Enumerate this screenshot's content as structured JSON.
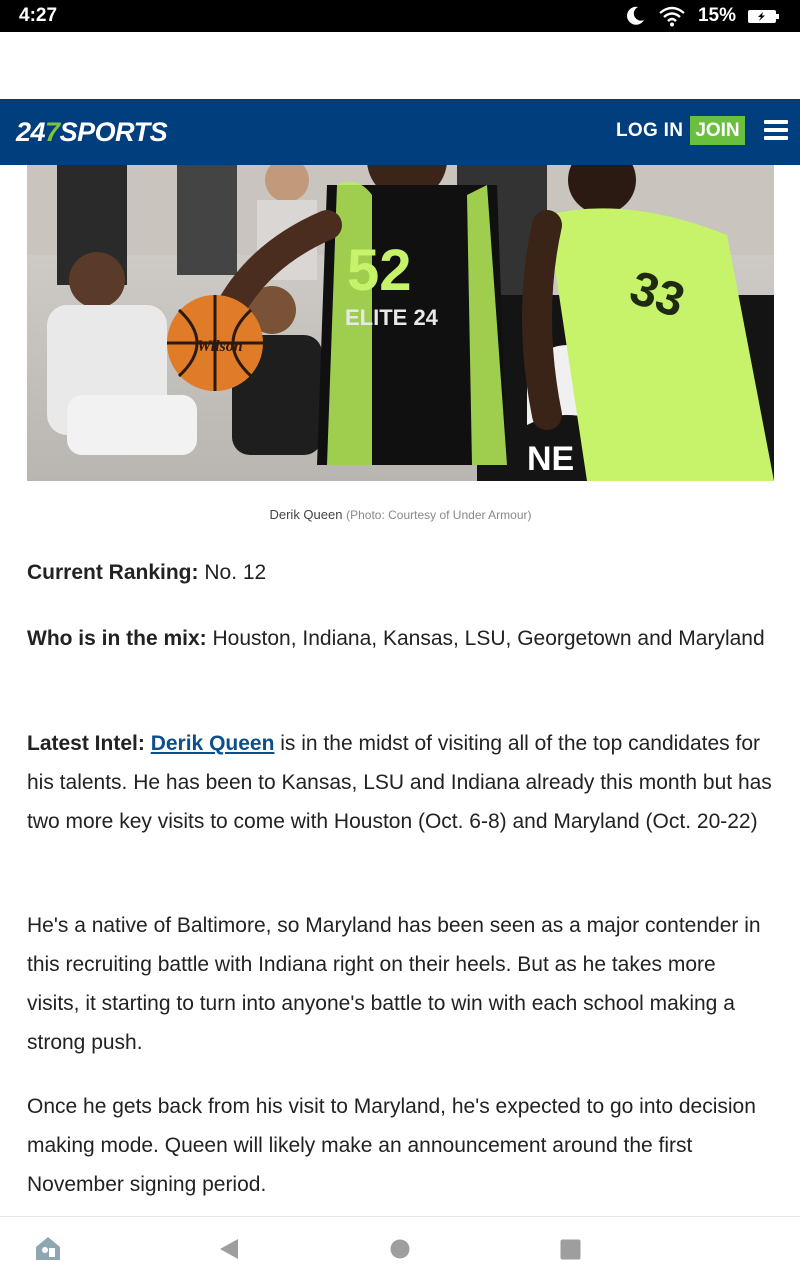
{
  "status": {
    "time": "4:27",
    "battery": "15%"
  },
  "header": {
    "logo_num_a": "24",
    "logo_num_b": "7",
    "logo_word": "SPORTS",
    "login": "LOG IN",
    "join": "JOIN"
  },
  "photo": {
    "jersey_main": "52",
    "jersey_sub": "ELITE 24",
    "jersey_other": "33",
    "ball_brand": "Wilson",
    "caption_name": "Derik Queen",
    "caption_credit": "(Photo: Courtesy of Under Armour)"
  },
  "article": {
    "ranking_label": "Current Ranking:",
    "ranking_value": " No. 12",
    "mix_label": "Who is in the mix:",
    "mix_value": " Houston, Indiana, Kansas, LSU, Georgetown and Maryland",
    "intel_label": "Latest Intel:",
    "intel_link": "Derik Queen",
    "intel_text": " is in the midst of visiting all of the top candidates for his talents. He has been to Kansas, LSU and Indiana already this month but has two more key visits to come with Houston (Oct. 6-8) and Maryland (Oct. 20-22)",
    "para2": "He's a native of Baltimore, so Maryland has been seen as a major contender in this recruiting battle with Indiana right on their heels.  But as he takes more visits, it starting to turn into anyone's battle to win with each school making a strong push.",
    "para3": "Once he gets back from his visit to Maryland, he's expected to go into decision making mode. Queen will likely make an announcement around the first November signing period."
  },
  "colors": {
    "header_bg": "#003e7e",
    "join_bg": "#6abf3f",
    "link": "#0b4f8c",
    "jersey_green": "#c6f36a"
  },
  "icons": [
    "moon-icon",
    "wifi-icon",
    "battery-icon",
    "menu-icon",
    "home-icon",
    "back-icon",
    "circle-home-icon",
    "recents-icon"
  ]
}
